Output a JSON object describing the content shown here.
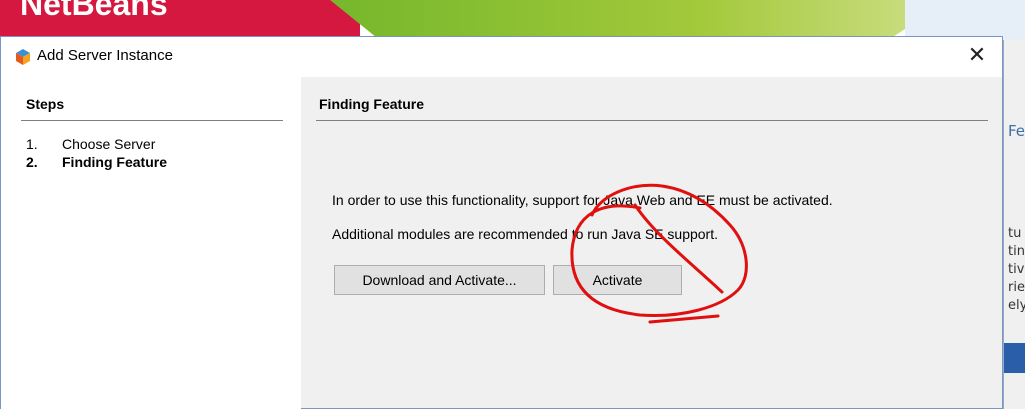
{
  "background": {
    "logo_text": "NetBeans",
    "underlying_window": {
      "text_fragment": "Fe",
      "side_fragments": [
        "tu",
        "tin",
        "tiv",
        "rie",
        "ely"
      ]
    }
  },
  "dialog": {
    "title": "Add Server Instance",
    "close_glyph": "✕",
    "steps": {
      "heading": "Steps",
      "items": [
        {
          "number": "1.",
          "label": "Choose Server",
          "current": false
        },
        {
          "number": "2.",
          "label": "Finding Feature",
          "current": true
        }
      ]
    },
    "content": {
      "heading": "Finding Feature",
      "message": "In order to use this functionality, support for Java Web and EE must be activated.",
      "sub_message": "Additional modules are recommended to run Java SE support.",
      "buttons": {
        "download_activate": "Download and Activate...",
        "activate": "Activate"
      }
    }
  },
  "colors": {
    "annotation_stroke": "#e01010",
    "accent_border": "#7a96c8",
    "banner_red": "#d5183f",
    "banner_green": "#76b72b"
  },
  "icons": {
    "title_icon": "netbeans-cube-icon",
    "close_icon": "close-icon"
  }
}
